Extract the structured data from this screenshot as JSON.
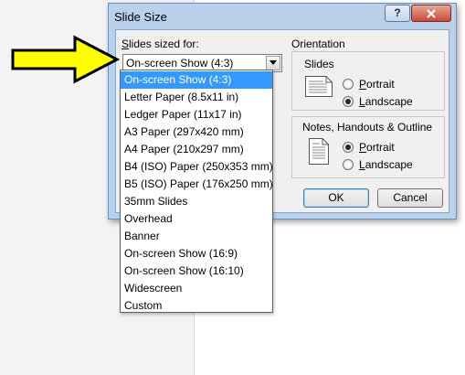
{
  "dialog": {
    "title": "Slide Size",
    "help_label": "?",
    "close_label": "x"
  },
  "sized_for": {
    "label_first": "S",
    "label_rest": "lides sized for:",
    "selected": "On-screen Show (4:3)",
    "options": [
      "On-screen Show (4:3)",
      "Letter Paper (8.5x11 in)",
      "Ledger Paper (11x17 in)",
      "A3 Paper (297x420 mm)",
      "A4 Paper (210x297 mm)",
      "B4 (ISO) Paper (250x353 mm)",
      "B5 (ISO) Paper (176x250 mm)",
      "35mm Slides",
      "Overhead",
      "Banner",
      "On-screen Show (16:9)",
      "On-screen Show (16:10)",
      "Widescreen",
      "Custom"
    ],
    "selected_index": 0
  },
  "orientation": {
    "label": "Orientation",
    "slides": {
      "label": "Slides",
      "portrait": "Portrait",
      "portrait_u": "P",
      "portrait_rest": "ortrait",
      "landscape_u": "L",
      "landscape_rest": "andscape",
      "selected": "landscape"
    },
    "notes": {
      "label": "Notes, Handouts & Outline",
      "portrait_u": "P",
      "portrait_rest": "ortrait",
      "landscape_u": "L",
      "landscape_rest": "andscape",
      "selected": "portrait"
    }
  },
  "buttons": {
    "ok": "OK",
    "cancel": "Cancel"
  },
  "colors": {
    "annotation_arrow": "#ffff00",
    "selection": "#3399ff"
  }
}
